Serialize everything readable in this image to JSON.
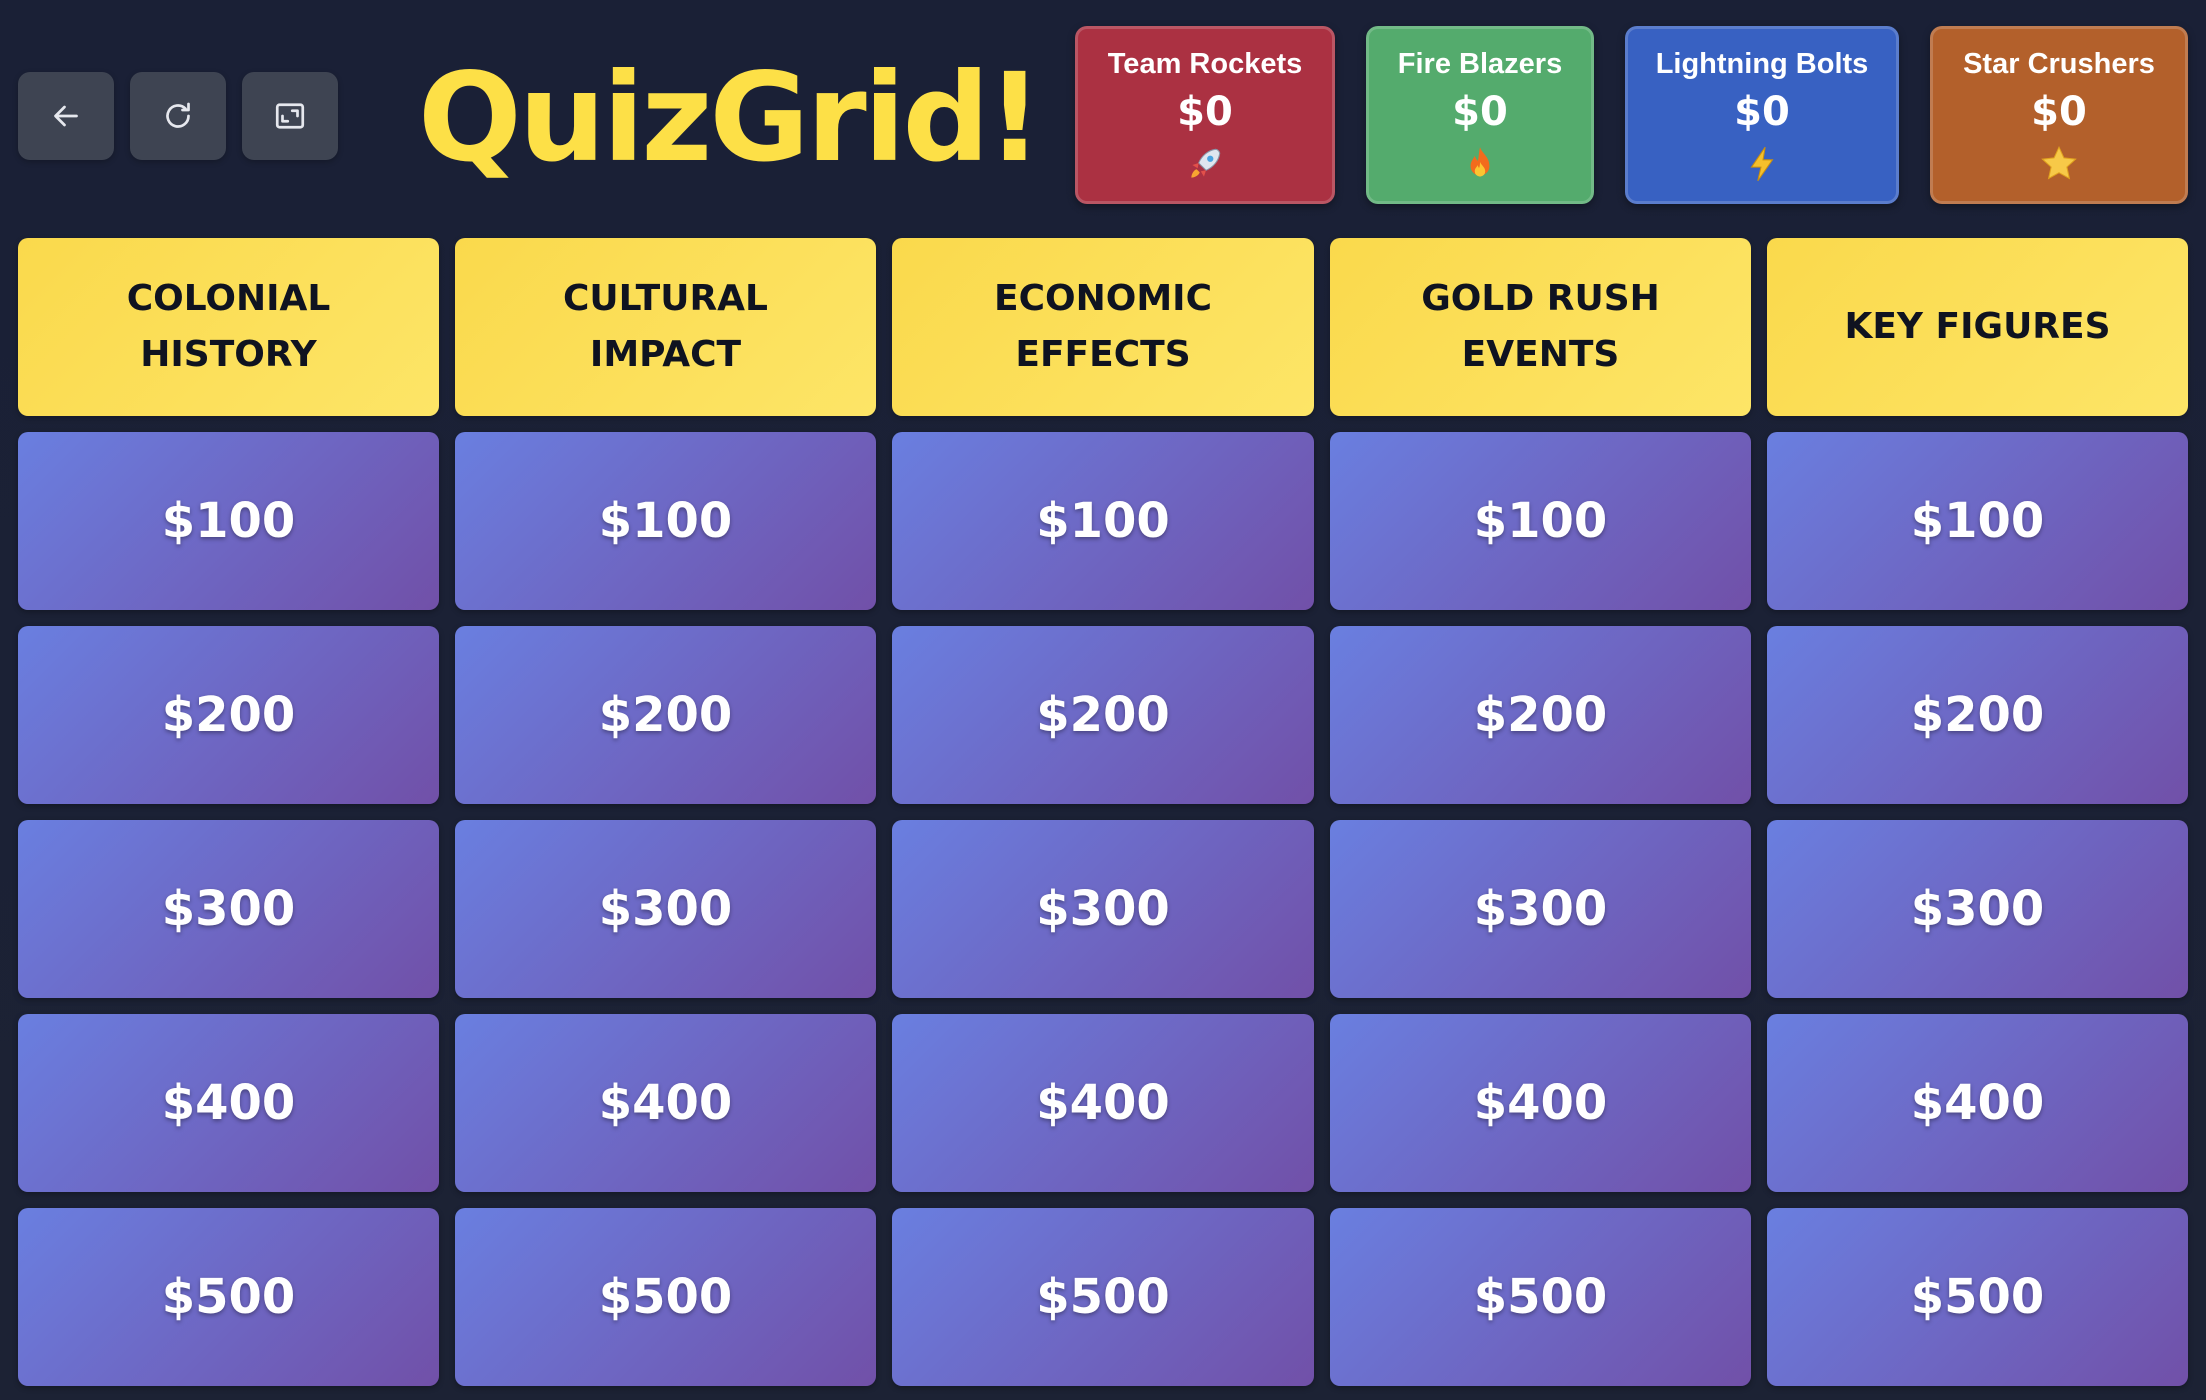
{
  "app": {
    "logo": "QuizGrid!"
  },
  "controls": {
    "back_icon": "arrow-left-icon",
    "reload_icon": "reload-icon",
    "fullscreen_icon": "fullscreen-icon"
  },
  "teams": [
    {
      "name": "Team Rockets",
      "score": "$0",
      "icon": "rocket-icon",
      "color": "#ab3142"
    },
    {
      "name": "Fire Blazers",
      "score": "$0",
      "icon": "fire-icon",
      "color": "#54ab6d"
    },
    {
      "name": "Lightning Bolts",
      "score": "$0",
      "icon": "lightning-icon",
      "color": "#3861c2"
    },
    {
      "name": "Star Crushers",
      "score": "$0",
      "icon": "star-icon",
      "color": "#b3602b"
    }
  ],
  "board": {
    "categories": [
      {
        "line1": "COLONIAL",
        "line2": "HISTORY"
      },
      {
        "line1": "CULTURAL",
        "line2": "IMPACT"
      },
      {
        "line1": "ECONOMIC",
        "line2": "EFFECTS"
      },
      {
        "line1": "GOLD RUSH",
        "line2": "EVENTS"
      },
      {
        "line1": "KEY FIGURES",
        "line2": ""
      }
    ],
    "values": [
      "$100",
      "$200",
      "$300",
      "$400",
      "$500"
    ]
  },
  "colors": {
    "category_bg": "#fde047",
    "cell_from": "#6a7fe0",
    "cell_to": "#7150a8",
    "background": "#1a2036"
  }
}
